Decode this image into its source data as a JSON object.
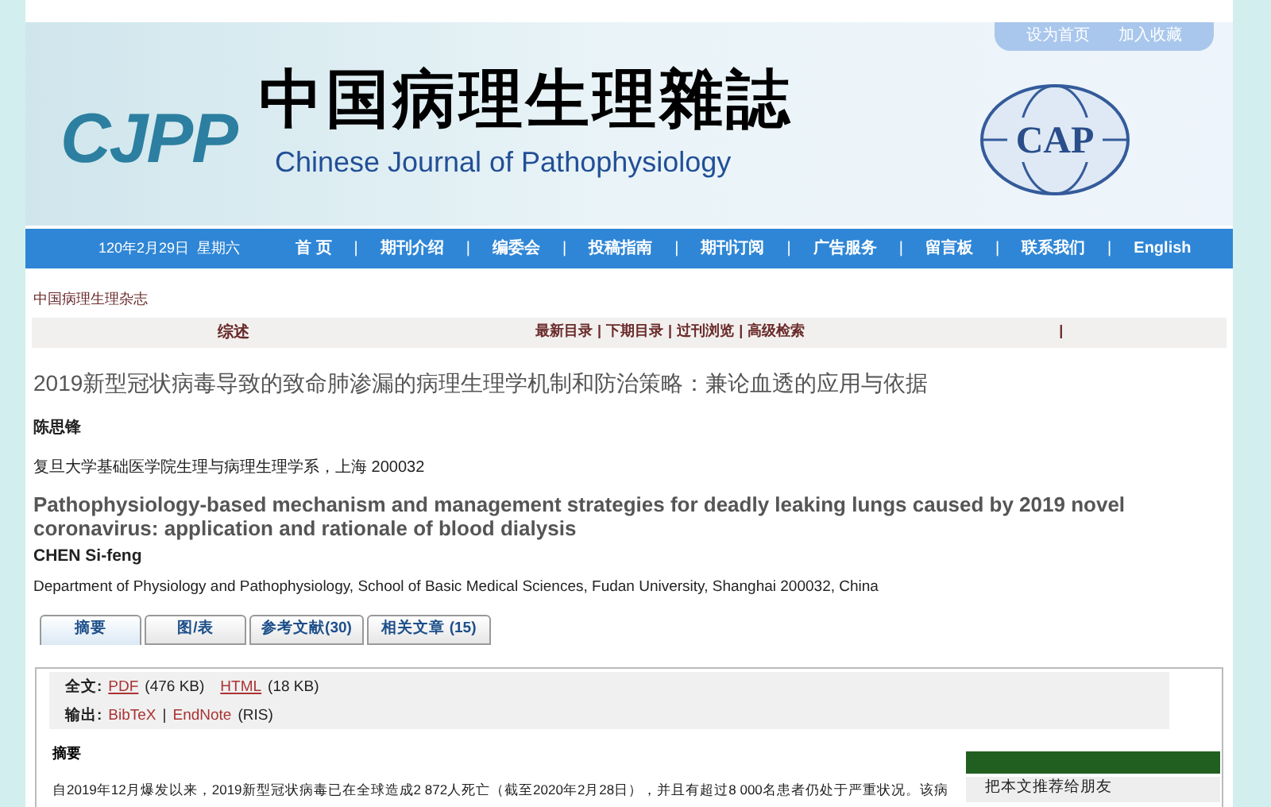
{
  "header": {
    "links": [
      "设为首页",
      "加入收藏"
    ],
    "logo": "CJPP",
    "title_cn": "中国病理生理雜誌",
    "title_en": "Chinese Journal of Pathophysiology",
    "emblem": "CAP"
  },
  "nav": {
    "date": "120年2月29日  星期六",
    "separator": "|",
    "items": [
      "首 页",
      "期刊介绍",
      "编委会",
      "投稿指南",
      "期刊订阅",
      "广告服务",
      "留言板",
      "联系我们",
      "English"
    ]
  },
  "breadcrumb": "中国病理生理杂志",
  "section_bar": {
    "category": "综述",
    "separator": "|",
    "links": [
      "最新目录",
      "下期目录",
      "过刊浏览",
      "高级检索"
    ]
  },
  "article": {
    "title_cn": "2019新型冠状病毒导致的致命肺渗漏的病理生理学机制和防治策略：兼论血透的应用与依据",
    "author_cn": "陈思锋",
    "affiliation_cn": "复旦大学基础医学院生理与病理生理学系，上海 200032",
    "title_en": "Pathophysiology-based mechanism and management strategies for deadly leaking lungs caused by 2019 novel coronavirus: application and rationale of blood dialysis",
    "author_en": "CHEN Si-feng",
    "affiliation_en": "Department of Physiology and Pathophysiology, School of Basic Medical Sciences, Fudan University, Shanghai 200032, China"
  },
  "tabs": [
    {
      "label": "摘要",
      "selected": true
    },
    {
      "label": "图/表",
      "selected": false
    },
    {
      "label": "参考文献(30)",
      "selected": false
    },
    {
      "label": "相关文章 (15)",
      "selected": false
    }
  ],
  "fulltext": {
    "label": "全文:",
    "links": [
      {
        "text": "PDF",
        "size": "(476 KB)"
      },
      {
        "text": "HTML",
        "size": "(18 KB)"
      }
    ]
  },
  "export": {
    "label": "输出:",
    "links": [
      "BibTeX",
      "EndNote"
    ],
    "separator": "|",
    "suffix": "(RIS)"
  },
  "abstract": {
    "heading": "摘要",
    "text": "自2019年12月爆发以来，2019新型冠状病毒已在全球造成2 872人死亡（截至2020年2月28日），并且有超过8 000名患者仍处于严重状况。该病"
  },
  "side_panel": {
    "action": "把本文推荐给朋友"
  }
}
